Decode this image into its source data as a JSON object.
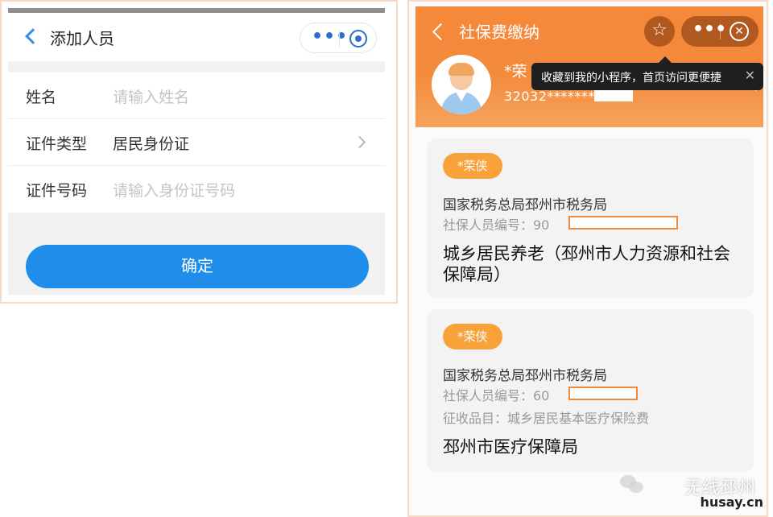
{
  "left": {
    "title": "添加人员",
    "more_label": "•••",
    "fields": [
      {
        "label": "姓名",
        "placeholder": "请输入姓名"
      },
      {
        "label": "证件类型",
        "value": "居民身份证"
      },
      {
        "label": "证件号码",
        "placeholder": "请输入身份证号码"
      }
    ],
    "confirm_label": "确定",
    "accent_color": "#1f8eea"
  },
  "right": {
    "title": "社保费缴纳",
    "star_icon": "☆",
    "more_label": "•••",
    "close_label": "✕",
    "user": {
      "name": "*荣",
      "id": "32032********"
    },
    "tooltip": {
      "text": "收藏到我的小程序，首页访问更便捷",
      "close": "✕"
    },
    "cards": [
      {
        "badge": "*荣侠",
        "org": "国家税务总局邳州市税务局",
        "staff_no_label": "社保人员编号：90",
        "bureau": "城乡居民养老（邳州市人力资源和社会保障局）"
      },
      {
        "badge": "*荣侠",
        "org": "国家税务总局邳州市税务局",
        "staff_no_label": "社保人员编号：60",
        "item_label": "征收品目：城乡居民基本医疗保险费",
        "bureau": "邳州市医疗保障局"
      }
    ],
    "header_color": "#f6883a",
    "badge_color": "#f9a23a"
  },
  "watermark": {
    "text": "无线邳州",
    "site": "husay.cn"
  }
}
